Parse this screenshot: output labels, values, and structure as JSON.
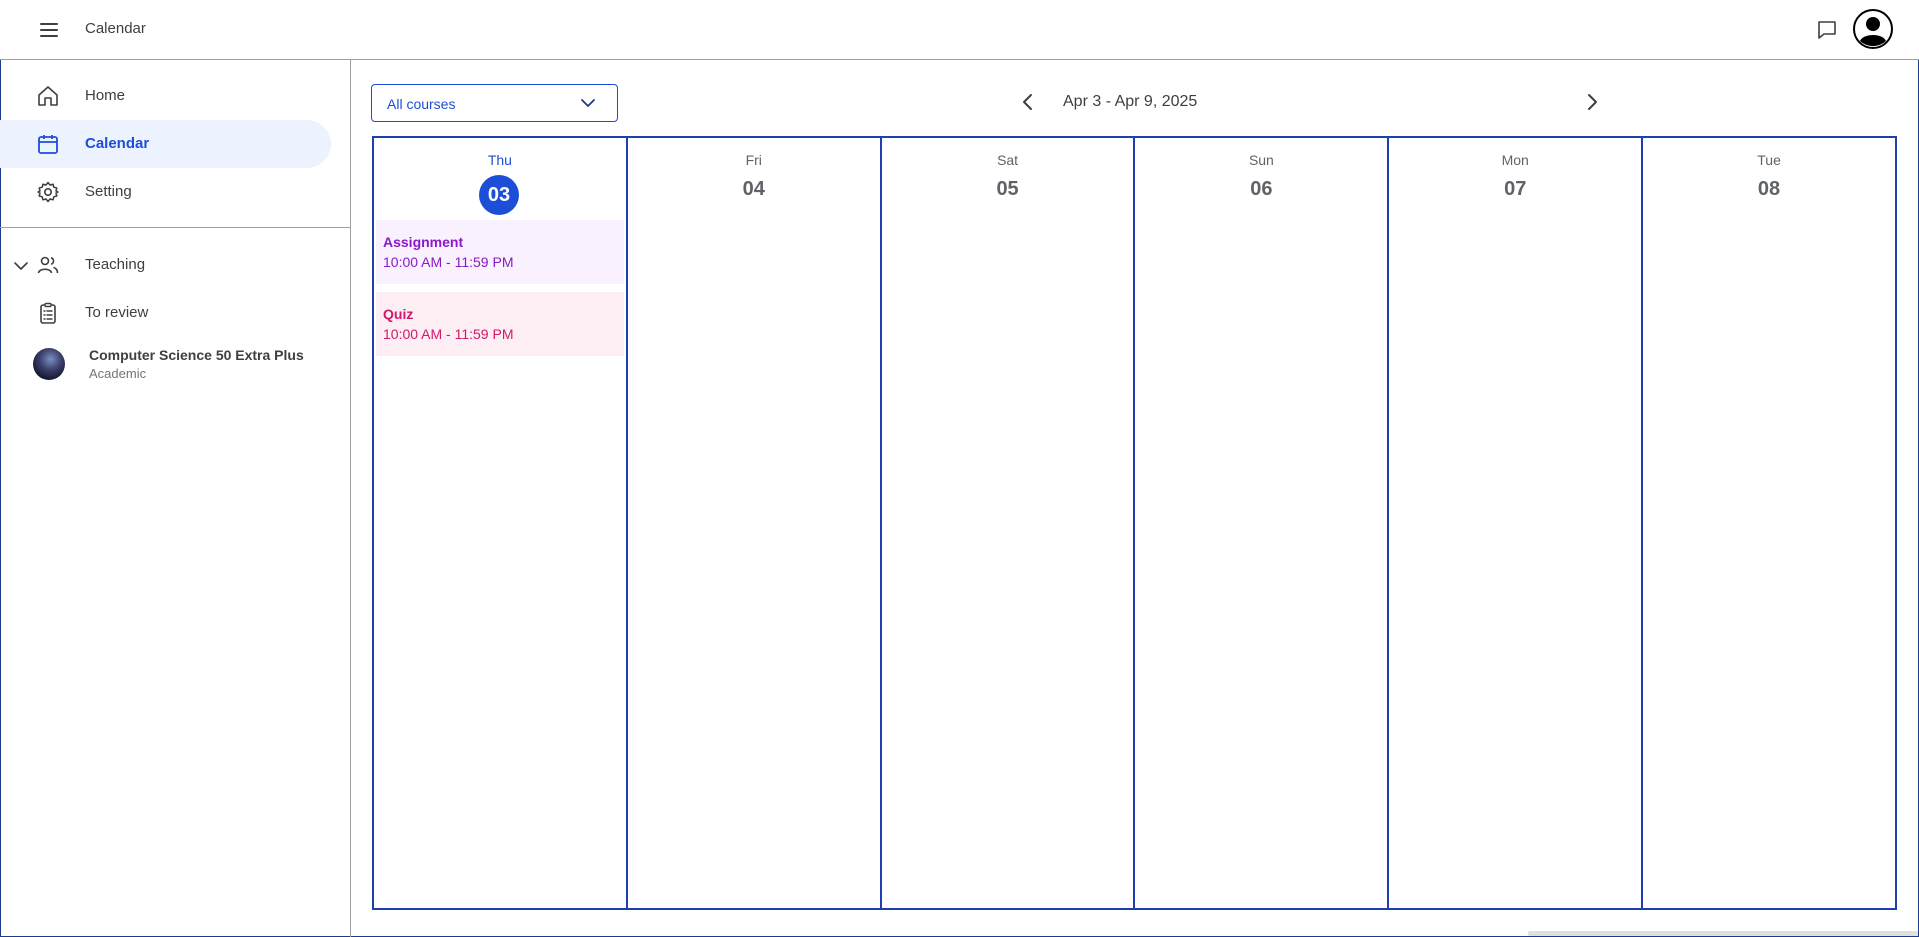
{
  "header": {
    "title": "Calendar"
  },
  "sidebar": {
    "nav": [
      {
        "label": "Home",
        "icon": "home-icon"
      },
      {
        "label": "Calendar",
        "icon": "calendar-icon",
        "active": true
      },
      {
        "label": "Setting",
        "icon": "gear-icon"
      }
    ],
    "teaching_label": "Teaching",
    "to_review_label": "To review",
    "course": {
      "name": "Computer Science 50 Extra Plus",
      "subtitle": "Academic"
    }
  },
  "main": {
    "course_filter": "All courses",
    "week_range": "Apr 3 - Apr 9, 2025",
    "days": [
      {
        "name": "Thu",
        "num": "03",
        "today": true
      },
      {
        "name": "Fri",
        "num": "04"
      },
      {
        "name": "Sat",
        "num": "05"
      },
      {
        "name": "Sun",
        "num": "06"
      },
      {
        "name": "Mon",
        "num": "07"
      },
      {
        "name": "Tue",
        "num": "08"
      }
    ],
    "events": [
      {
        "title": "Assignment",
        "time": "10:00 AM - 11:59 PM"
      },
      {
        "title": "Quiz",
        "time": "10:00 AM - 11:59 PM"
      }
    ]
  },
  "colors": {
    "accent": "#1d4ed8",
    "assignment": "#8b19c9",
    "quiz": "#d3176e",
    "active_bg": "#ecf3fe"
  }
}
